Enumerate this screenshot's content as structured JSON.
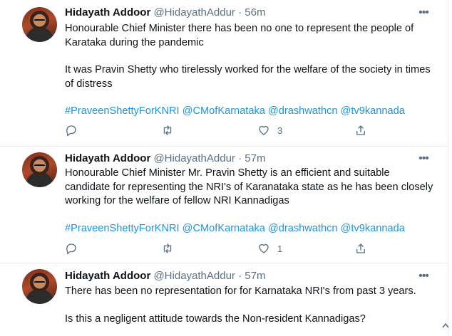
{
  "tweets": [
    {
      "name": "Hidayath Addoor",
      "handle": "@HidayathAddur",
      "dot": "·",
      "time": "56m",
      "more": "•••",
      "paragraphs": [
        "Honourable Chief Minister there has been no one to represent the people of Karataka during the pandemic",
        "It was Pravin Shetty who tirelessly worked for the welfare of the society in times of distress"
      ],
      "hashtags": "#PraveenShettyForKNRI @CMofKarnataka @drashwathcn @tv9kannada",
      "likes": "3"
    },
    {
      "name": "Hidayath Addoor",
      "handle": "@HidayathAddur",
      "dot": "·",
      "time": "57m",
      "more": "•••",
      "paragraphs": [
        "Honourable Chief Minister Mr. Pravin Shetty is an efficient and suitable candidate for representing the NRI's of Karanataka state as he has been closely working for the welfare of fellow NRI Kannadigas"
      ],
      "hashtags": "#PraveenShettyForKNRI @CMofKarnataka @drashwathcn @tv9kannada",
      "likes": "1"
    },
    {
      "name": "Hidayath Addoor",
      "handle": "@HidayathAddur",
      "dot": "·",
      "time": "57m",
      "more": "•••",
      "paragraphs": [
        "There has been no representation for for Karnataka NRI's from past 3 years.",
        "Is this a negligent attitude towards the Non-resident Kannadigas?"
      ]
    }
  ],
  "icons": {
    "reply": "reply-icon",
    "retweet": "retweet-icon",
    "like": "heart-icon",
    "share": "share-icon",
    "more": "more-icon"
  },
  "colors": {
    "link": "#1b95e0",
    "secondary_text": "#5b7083",
    "divider": "#e6ecf0"
  }
}
